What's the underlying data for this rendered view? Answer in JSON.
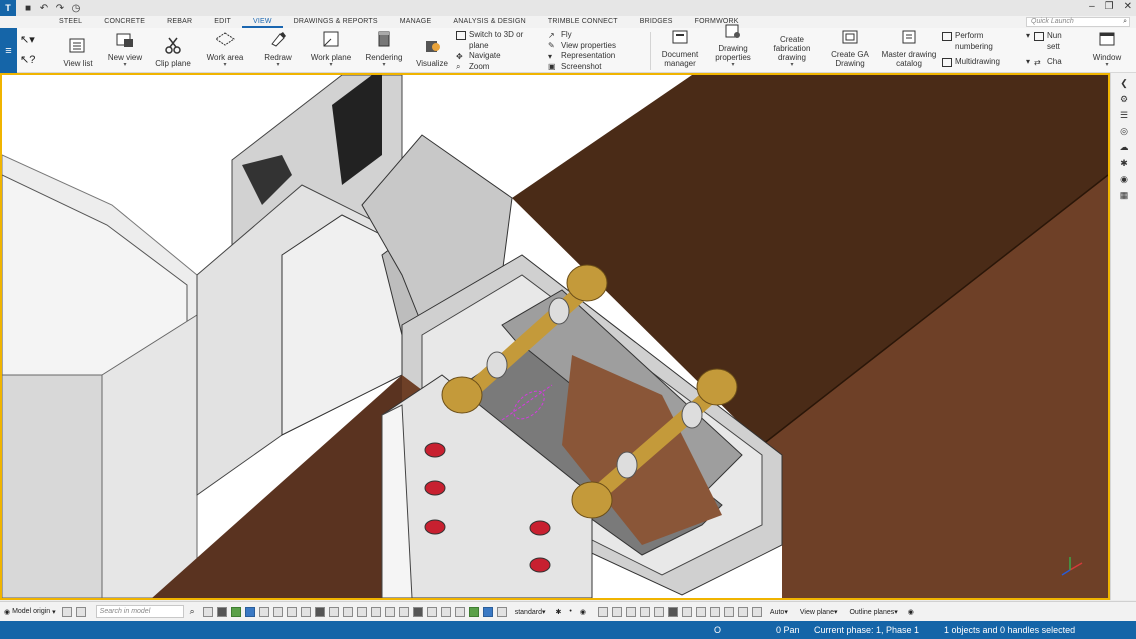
{
  "titlebar": {
    "logo": "T",
    "quick_access": [
      "save",
      "undo",
      "redo",
      "history"
    ],
    "window_controls": [
      "minimize",
      "restore",
      "close"
    ]
  },
  "menu": {
    "tabs": [
      "STEEL",
      "CONCRETE",
      "REBAR",
      "EDIT",
      "VIEW",
      "DRAWINGS & REPORTS",
      "MANAGE",
      "ANALYSIS & DESIGN",
      "TRIMBLE CONNECT",
      "BRIDGES",
      "FORMWORK"
    ],
    "active_tab": "VIEW",
    "quick_launch_placeholder": "Quick Launch"
  },
  "ribbon": {
    "view_list": "View list",
    "new_view": "New view",
    "clip_plane": "Clip plane",
    "work_area": "Work area",
    "redraw": "Redraw",
    "work_plane": "Work plane",
    "rendering": "Rendering",
    "visualize": "Visualize",
    "switch_3d_line1": "Switch to 3D or",
    "switch_3d_line2": "plane",
    "navigate": "Navigate",
    "zoom": "Zoom",
    "fly": "Fly",
    "view_properties": "View properties",
    "representation": "Representation",
    "screenshot": "Screenshot",
    "document_manager_line1": "Document",
    "document_manager_line2": "manager",
    "drawing_properties_line1": "Drawing",
    "drawing_properties_line2": "properties",
    "create_fab_line1": "Create",
    "create_fab_line2": "fabrication",
    "create_fab_line3": "drawing",
    "create_ga_line1": "Create GA",
    "create_ga_line2": "Drawing",
    "master_catalog_line1": "Master drawing",
    "master_catalog_line2": "catalog",
    "perform_numbering_line1": "Perform",
    "perform_numbering_line2": "numbering",
    "multidrawing": "Multidrawing",
    "num_settings_line1": "Nun",
    "num_settings_line2": "sett",
    "cha": "Cha",
    "window": "Window"
  },
  "bottom_toolbar": {
    "model_origin": "Model origin",
    "search_placeholder": "Search in model",
    "standard": "standard",
    "auto": "Auto",
    "view_plane": "View plane",
    "outline_planes": "Outline planes"
  },
  "statusbar": {
    "o_label": "O",
    "pan": "0 Pan",
    "phase": "Current phase: 1, Phase 1",
    "selection": "1 objects and 0 handles selected"
  },
  "colors": {
    "brand_blue": "#1565a8",
    "viewport_border": "#f0b400",
    "wood_dark": "#4a2b17",
    "wood_light": "#7a4a30",
    "bolt_gold": "#c49a3a",
    "highlight_magenta": "#d43adf",
    "hole_red": "#c82030"
  }
}
